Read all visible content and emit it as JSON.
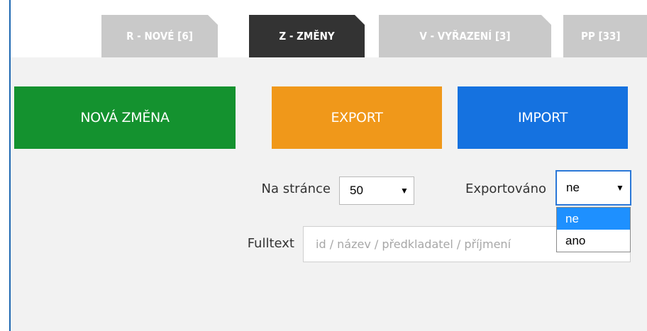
{
  "tabs": [
    {
      "label": "R - NOVÉ [6]",
      "active": false
    },
    {
      "label": "Z - ZMĚNY",
      "active": true
    },
    {
      "label": "V - VYŘAZENÍ [3]",
      "active": false
    },
    {
      "label": "PP [33]",
      "active": false
    }
  ],
  "actions": {
    "new_change": "NOVÁ ZMĚNA",
    "export": "EXPORT",
    "import": "IMPORT"
  },
  "colors": {
    "new_change": "#14922f",
    "export": "#f0981a",
    "import": "#1572e0",
    "tab_active": "#333333",
    "tab_inactive": "#c9c9c9",
    "dropdown_highlight": "#1e90ff"
  },
  "filters": {
    "per_page_label": "Na stránce",
    "per_page_value": "50",
    "exported_label": "Exportováno",
    "exported_value": "ne",
    "exported_options": [
      "ne",
      "ano"
    ],
    "fulltext_label": "Fulltext",
    "fulltext_placeholder": "id / název / předkladatel / příjmení"
  }
}
